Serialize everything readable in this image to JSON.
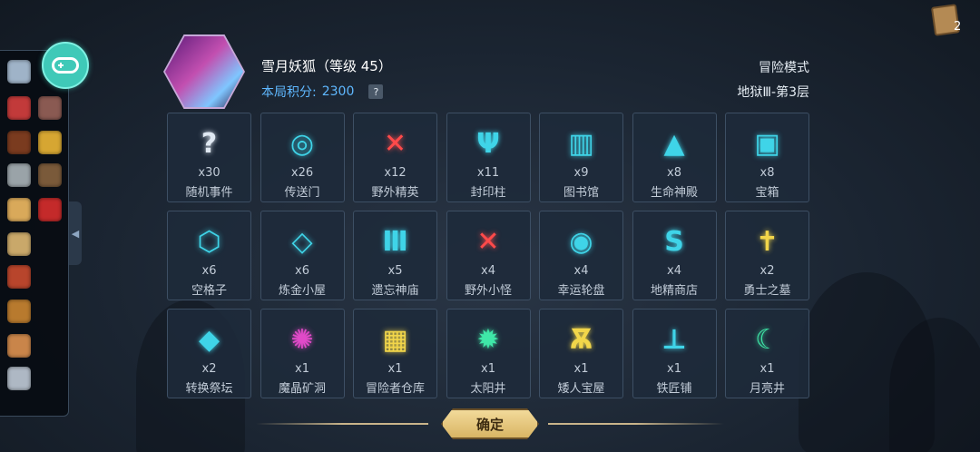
{
  "header": {
    "hero_name": "雪月妖狐（等级 45）",
    "score_label": "本局积分:",
    "score_value": "2300",
    "help_icon": "?",
    "mode": "冒险模式",
    "floor": "地狱Ⅲ-第3层"
  },
  "deck": {
    "count": "2"
  },
  "sidebar": {
    "toggle_icon": "◀",
    "items": [
      {
        "icon": "feather-quill-icon",
        "color": "#9fb3c8"
      },
      {
        "icon": "candy-icon",
        "color": "#c23a3a"
      },
      {
        "icon": "rock-icon",
        "color": "#8a5a52"
      },
      {
        "icon": "book-icon",
        "color": "#7a3b1f"
      },
      {
        "icon": "key-icon",
        "color": "#d6a632"
      },
      {
        "icon": "stone-tablet-icon",
        "color": "#9aa3a8"
      },
      {
        "icon": "horned-helmet-icon",
        "color": "#7a5a3a"
      },
      {
        "icon": "scroll-icon",
        "color": "#d9a95a"
      },
      {
        "icon": "meat-icon",
        "color": "#c42a2a"
      },
      {
        "icon": "map-scroll-icon",
        "color": "#c9a86a"
      },
      {
        "icon": "steak-icon",
        "color": "#b8452c"
      },
      {
        "icon": "money-bag-icon",
        "color": "#b87a2e"
      },
      {
        "icon": "rolled-scroll-icon",
        "color": "#c9854a"
      },
      {
        "icon": "page-icon",
        "color": "#aeb8c4"
      }
    ]
  },
  "cells": [
    {
      "icon": "question-icon",
      "glyph": "?",
      "color": "#dfe8f2",
      "count": "x30",
      "label": "随机事件"
    },
    {
      "icon": "portal-icon",
      "glyph": "◎",
      "color": "#3fd4e8",
      "count": "x26",
      "label": "传送门"
    },
    {
      "icon": "crossed-axes-icon",
      "glyph": "✕",
      "color": "#ff4a4a",
      "count": "x12",
      "label": "野外精英"
    },
    {
      "icon": "seal-pillar-icon",
      "glyph": "Ψ",
      "color": "#3fd4e8",
      "count": "x11",
      "label": "封印柱"
    },
    {
      "icon": "open-book-icon",
      "glyph": "▥",
      "color": "#3fd4e8",
      "count": "x9",
      "label": "图书馆"
    },
    {
      "icon": "temple-icon",
      "glyph": "▲",
      "color": "#3fd4e8",
      "count": "x8",
      "label": "生命神殿"
    },
    {
      "icon": "chest-monster-icon",
      "glyph": "▣",
      "color": "#3fd4e8",
      "count": "x8",
      "label": "宝箱"
    },
    {
      "icon": "hexagon-icon",
      "glyph": "⬡",
      "color": "#3fd4e8",
      "count": "x6",
      "label": "空格子"
    },
    {
      "icon": "alchemy-icon",
      "glyph": "◇",
      "color": "#3fd4e8",
      "count": "x6",
      "label": "炼金小屋"
    },
    {
      "icon": "ruined-temple-icon",
      "glyph": "Ⅲ",
      "color": "#3fd4e8",
      "count": "x5",
      "label": "遗忘神庙"
    },
    {
      "icon": "crossed-swords-icon",
      "glyph": "✕",
      "color": "#ff4a4a",
      "count": "x4",
      "label": "野外小怪"
    },
    {
      "icon": "wheel-icon",
      "glyph": "◉",
      "color": "#3fd4e8",
      "count": "x4",
      "label": "幸运轮盘"
    },
    {
      "icon": "gnome-shop-icon",
      "glyph": "S",
      "color": "#3fd4e8",
      "count": "x4",
      "label": "地精商店"
    },
    {
      "icon": "tombstone-icon",
      "glyph": "✝",
      "color": "#f2d64a",
      "count": "x2",
      "label": "勇士之墓"
    },
    {
      "icon": "altar-icon",
      "glyph": "◆",
      "color": "#3fd4e8",
      "count": "x2",
      "label": "转换祭坛"
    },
    {
      "icon": "crystal-mine-icon",
      "glyph": "✺",
      "color": "#e04ac8",
      "count": "x1",
      "label": "魔晶矿洞"
    },
    {
      "icon": "warehouse-icon",
      "glyph": "▦",
      "color": "#f2d64a",
      "count": "x1",
      "label": "冒险者仓库"
    },
    {
      "icon": "sun-well-icon",
      "glyph": "✹",
      "color": "#3fe8a8",
      "count": "x1",
      "label": "太阳井"
    },
    {
      "icon": "dwarf-vault-icon",
      "glyph": "Ѫ",
      "color": "#f2d64a",
      "count": "x1",
      "label": "矮人宝屋"
    },
    {
      "icon": "anvil-icon",
      "glyph": "⊥",
      "color": "#3fd4e8",
      "count": "x1",
      "label": "铁匠铺"
    },
    {
      "icon": "moon-well-icon",
      "glyph": "☾",
      "color": "#3fe8a8",
      "count": "x1",
      "label": "月亮井"
    }
  ],
  "footer": {
    "confirm_label": "确定"
  }
}
